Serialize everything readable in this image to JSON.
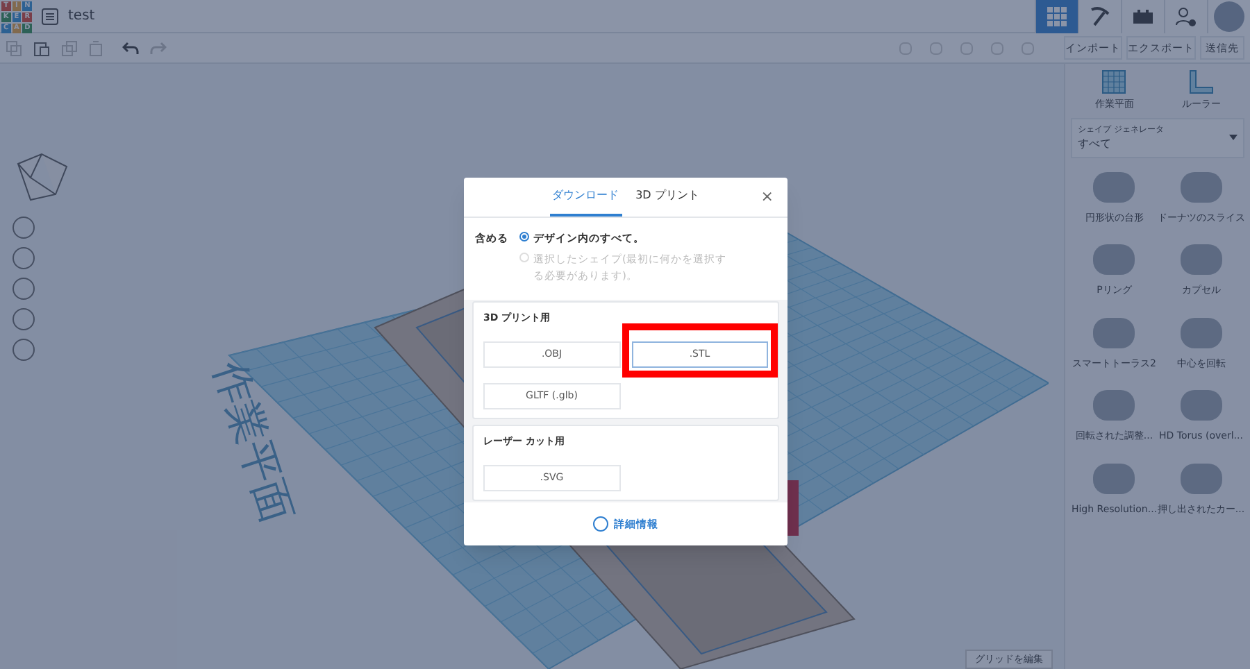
{
  "app": {
    "logo_letters": [
      "T",
      "I",
      "N",
      "K",
      "E",
      "R",
      "C",
      "A",
      "D"
    ],
    "design_name": "test"
  },
  "top_icons": [
    {
      "kind": "grid",
      "selected": true
    },
    {
      "kind": "pickaxe",
      "selected": false
    },
    {
      "kind": "bricks",
      "selected": false
    },
    {
      "kind": "user-add",
      "selected": false
    },
    {
      "kind": "avatar",
      "selected": false
    }
  ],
  "toolbar_actions": [
    "インポート",
    "エクスポート",
    "送信先"
  ],
  "panel_tools": [
    {
      "kind": "workplane",
      "label": "作業平面"
    },
    {
      "kind": "ruler",
      "label": "ルーラー"
    }
  ],
  "shape_generator": {
    "label": "シェイプ ジェネレータ",
    "value": "すべて"
  },
  "shapes": [
    {
      "label": "円形状の台形"
    },
    {
      "label": "ドーナツのスライス"
    },
    {
      "label": "Pリング"
    },
    {
      "label": "カプセル"
    },
    {
      "label": "スマートトーラス2"
    },
    {
      "label": "中心を回転"
    },
    {
      "label": "回転された調整..."
    },
    {
      "label": "HD Torus (overl..."
    },
    {
      "label": "High Resolution..."
    },
    {
      "label": "押し出されたカー..."
    }
  ],
  "canvas": {
    "workplane_label": "作業平面",
    "edit_grid_button": "グリッドを編集"
  },
  "dialog": {
    "tabs": [
      {
        "label": "ダウンロード",
        "selected": true
      },
      {
        "label": "3D プリント",
        "selected": false
      }
    ],
    "include_label": "含める",
    "options": [
      {
        "label": "デザイン内のすべて。",
        "selected": true,
        "disabled": false
      },
      {
        "label": "選択したシェイプ(最初に何かを選択する必要があります)。",
        "selected": false,
        "disabled": true
      }
    ],
    "sections": [
      {
        "title": "3D プリント用",
        "formats": [
          {
            "label": ".OBJ",
            "highlighted": false
          },
          {
            "label": ".STL",
            "highlighted": true
          },
          {
            "label": "GLTF (.glb)",
            "highlighted": false
          }
        ]
      },
      {
        "title": "レーザー カット用",
        "formats": [
          {
            "label": ".SVG",
            "highlighted": false
          }
        ]
      }
    ],
    "help_link": "詳細情報",
    "close_glyph": "×"
  }
}
